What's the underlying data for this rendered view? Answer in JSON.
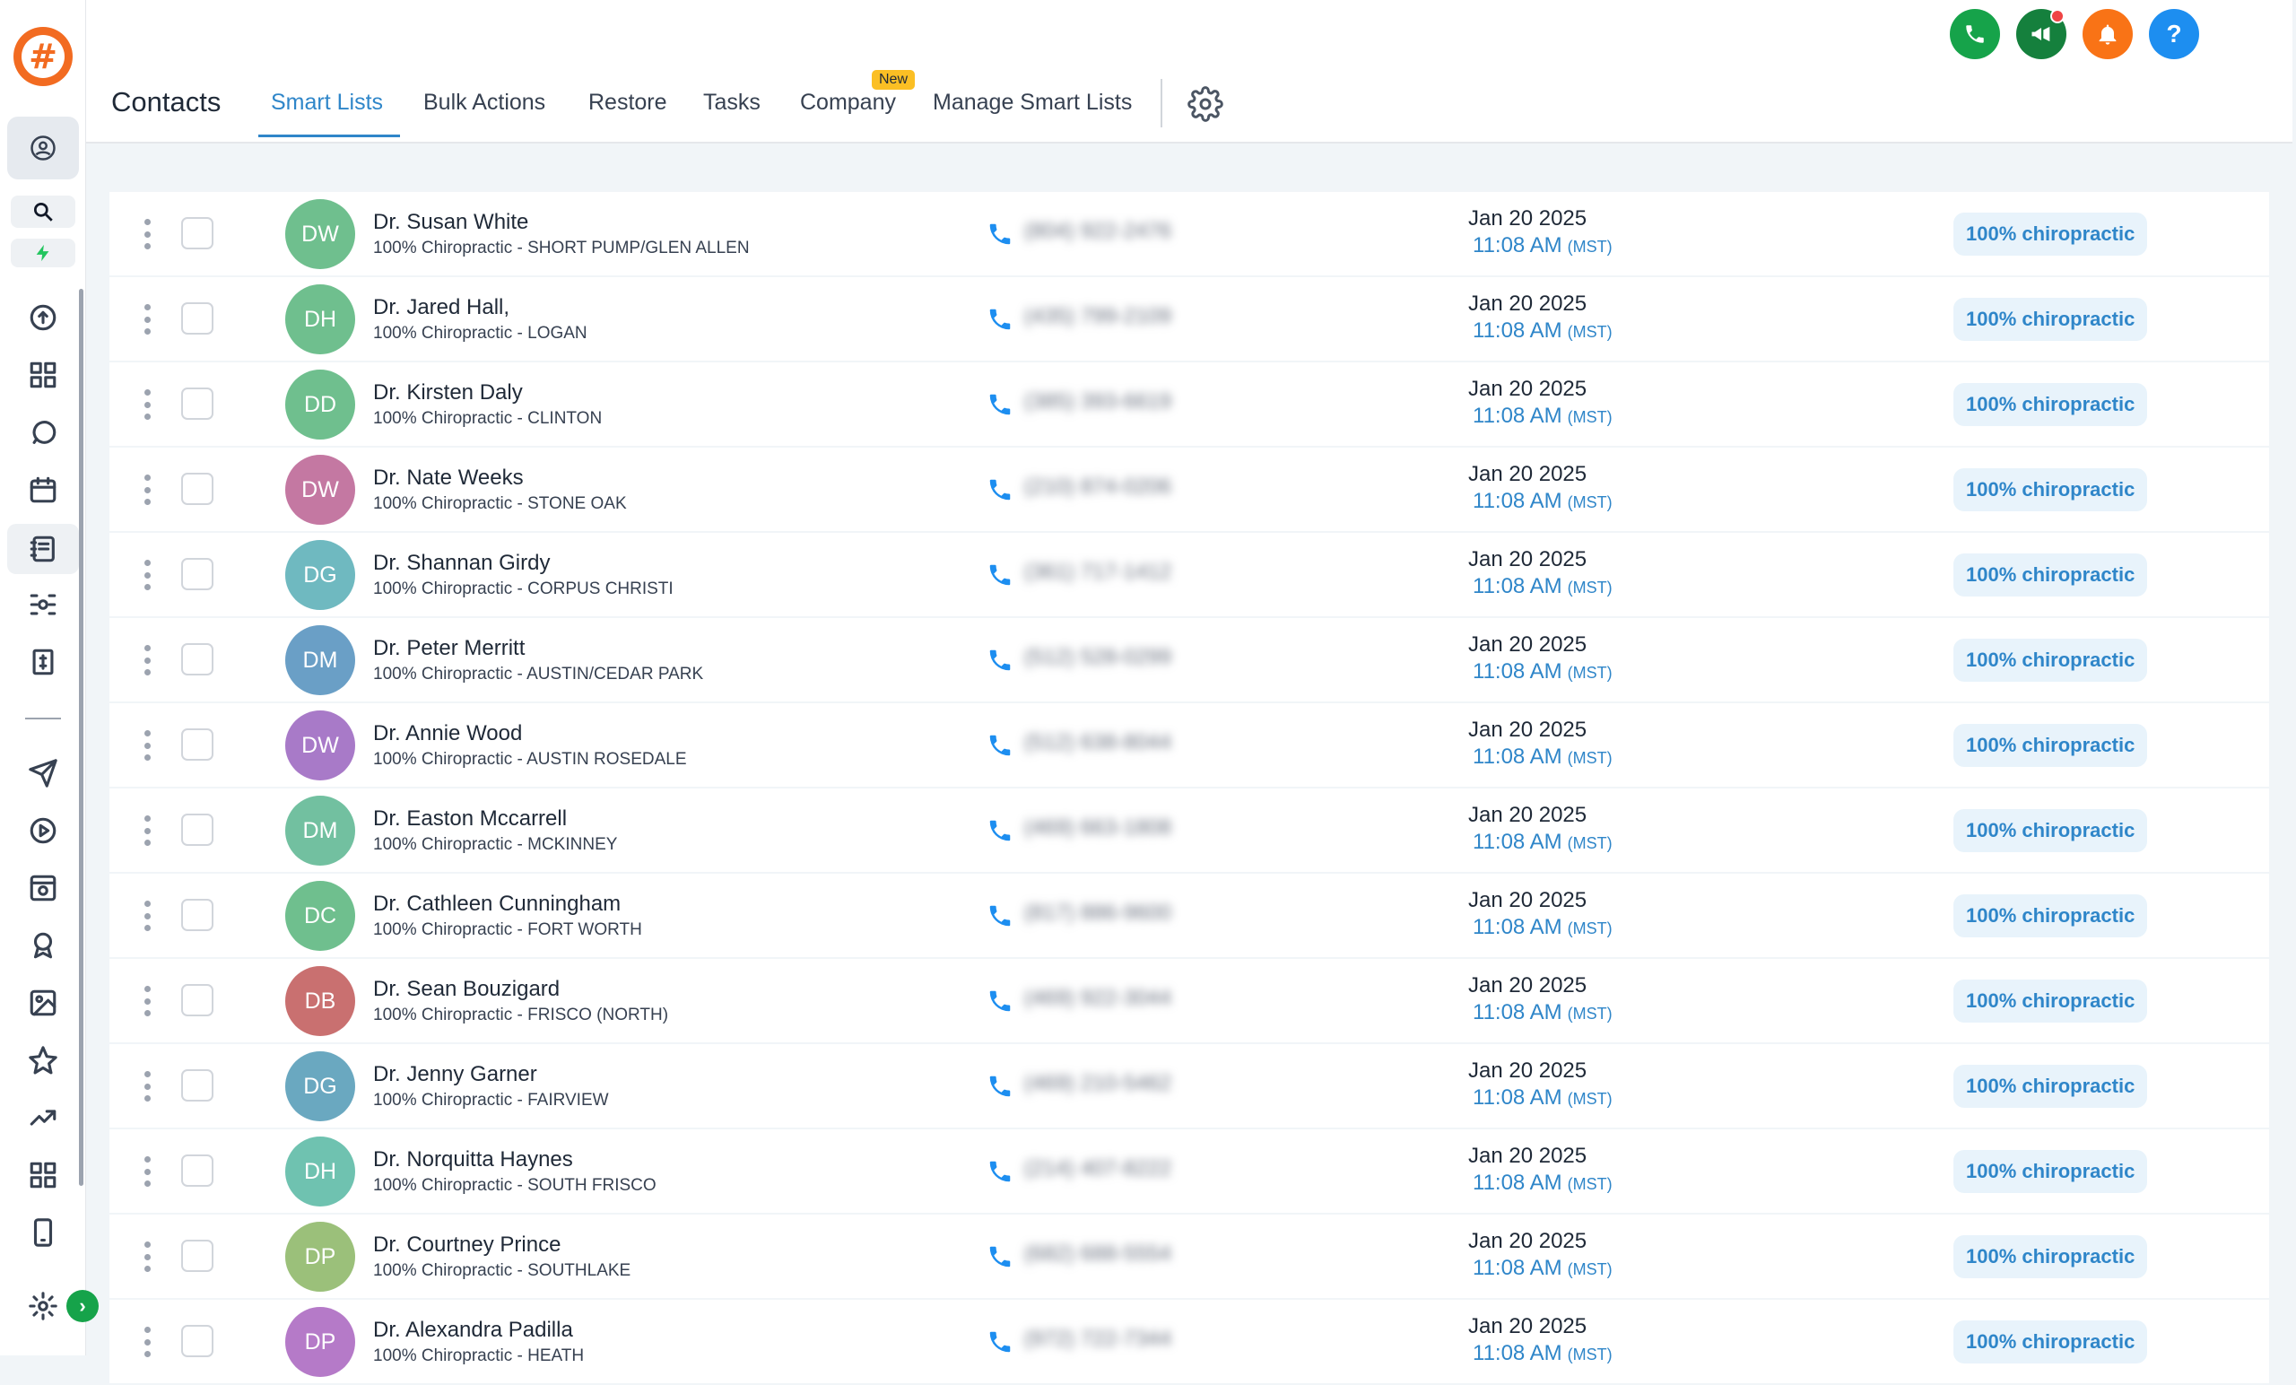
{
  "header": {
    "title": "Contacts",
    "tabs": [
      {
        "label": "Smart Lists",
        "active": true
      },
      {
        "label": "Bulk Actions"
      },
      {
        "label": "Restore"
      },
      {
        "label": "Tasks"
      },
      {
        "label": "Company",
        "badge": "New"
      },
      {
        "label": "Manage Smart Lists"
      }
    ]
  },
  "top_actions": [
    {
      "name": "phone-icon",
      "color": "#16a34a"
    },
    {
      "name": "megaphone-icon",
      "color": "#15803d"
    },
    {
      "name": "bell-icon",
      "color": "#f97316"
    },
    {
      "name": "help-icon",
      "color": "#1d8ef0",
      "label": "?"
    }
  ],
  "contacts": [
    {
      "initials": "DW",
      "color": "#6fbf8e",
      "name": "Dr. Susan White",
      "sub": "100% Chiropractic - SHORT PUMP/GLEN ALLEN",
      "phone": "(804) 922-2476",
      "date": "Jan 20 2025",
      "time": "11:08 AM",
      "tz": "(MST)",
      "tag": "100% chiropractic"
    },
    {
      "initials": "DH",
      "color": "#6fbf8e",
      "name": "Dr. Jared Hall,",
      "sub": "100% Chiropractic - LOGAN",
      "phone": "(435) 799-2109",
      "date": "Jan 20 2025",
      "time": "11:08 AM",
      "tz": "(MST)",
      "tag": "100% chiropractic"
    },
    {
      "initials": "DD",
      "color": "#6fbf8e",
      "name": "Dr. Kirsten Daly",
      "sub": "100% Chiropractic - CLINTON",
      "phone": "(385) 393-6619",
      "date": "Jan 20 2025",
      "time": "11:08 AM",
      "tz": "(MST)",
      "tag": "100% chiropractic"
    },
    {
      "initials": "DW",
      "color": "#c478a2",
      "name": "Dr. Nate Weeks",
      "sub": "100% Chiropractic - STONE OAK",
      "phone": "(210) 874-0206",
      "date": "Jan 20 2025",
      "time": "11:08 AM",
      "tz": "(MST)",
      "tag": "100% chiropractic"
    },
    {
      "initials": "DG",
      "color": "#6fb9c0",
      "name": "Dr. Shannan Girdy",
      "sub": "100% Chiropractic - CORPUS CHRISTI",
      "phone": "(361) 717-1412",
      "date": "Jan 20 2025",
      "time": "11:08 AM",
      "tz": "(MST)",
      "tag": "100% chiropractic"
    },
    {
      "initials": "DM",
      "color": "#6a9fc6",
      "name": "Dr. Peter Merritt",
      "sub": "100% Chiropractic - AUSTIN/CEDAR PARK",
      "phone": "(512) 528-0299",
      "date": "Jan 20 2025",
      "time": "11:08 AM",
      "tz": "(MST)",
      "tag": "100% chiropractic"
    },
    {
      "initials": "DW",
      "color": "#a87ac8",
      "name": "Dr. Annie Wood",
      "sub": "100% Chiropractic - AUSTIN ROSEDALE",
      "phone": "(512) 638-8044",
      "date": "Jan 20 2025",
      "time": "11:08 AM",
      "tz": "(MST)",
      "tag": "100% chiropractic"
    },
    {
      "initials": "DM",
      "color": "#72c0a0",
      "name": "Dr. Easton Mccarrell",
      "sub": "100% Chiropractic - MCKINNEY",
      "phone": "(469) 663-1808",
      "date": "Jan 20 2025",
      "time": "11:08 AM",
      "tz": "(MST)",
      "tag": "100% chiropractic"
    },
    {
      "initials": "DC",
      "color": "#6fbf8e",
      "name": "Dr. Cathleen Cunningham",
      "sub": "100% Chiropractic - FORT WORTH",
      "phone": "(817) 886-9600",
      "date": "Jan 20 2025",
      "time": "11:08 AM",
      "tz": "(MST)",
      "tag": "100% chiropractic"
    },
    {
      "initials": "DB",
      "color": "#c97070",
      "name": "Dr. Sean Bouzigard",
      "sub": "100% Chiropractic - FRISCO (NORTH)",
      "phone": "(469) 922-3044",
      "date": "Jan 20 2025",
      "time": "11:08 AM",
      "tz": "(MST)",
      "tag": "100% chiropractic"
    },
    {
      "initials": "DG",
      "color": "#6aa8c0",
      "name": "Dr. Jenny Garner",
      "sub": "100% Chiropractic - FAIRVIEW",
      "phone": "(469) 210-5462",
      "date": "Jan 20 2025",
      "time": "11:08 AM",
      "tz": "(MST)",
      "tag": "100% chiropractic"
    },
    {
      "initials": "DH",
      "color": "#6fc2b0",
      "name": "Dr. Norquitta Haynes",
      "sub": "100% Chiropractic - SOUTH FRISCO",
      "phone": "(214) 407-8222",
      "date": "Jan 20 2025",
      "time": "11:08 AM",
      "tz": "(MST)",
      "tag": "100% chiropractic"
    },
    {
      "initials": "DP",
      "color": "#9bc07a",
      "name": "Dr. Courtney Prince",
      "sub": "100% Chiropractic - SOUTHLAKE",
      "phone": "(682) 688-5554",
      "date": "Jan 20 2025",
      "time": "11:08 AM",
      "tz": "(MST)",
      "tag": "100% chiropractic"
    },
    {
      "initials": "DP",
      "color": "#b57ac8",
      "name": "Dr. Alexandra Padilla",
      "sub": "100% Chiropractic - HEATH",
      "phone": "(972) 722-7344",
      "date": "Jan 20 2025",
      "time": "11:08 AM",
      "tz": "(MST)",
      "tag": "100% chiropractic"
    }
  ]
}
